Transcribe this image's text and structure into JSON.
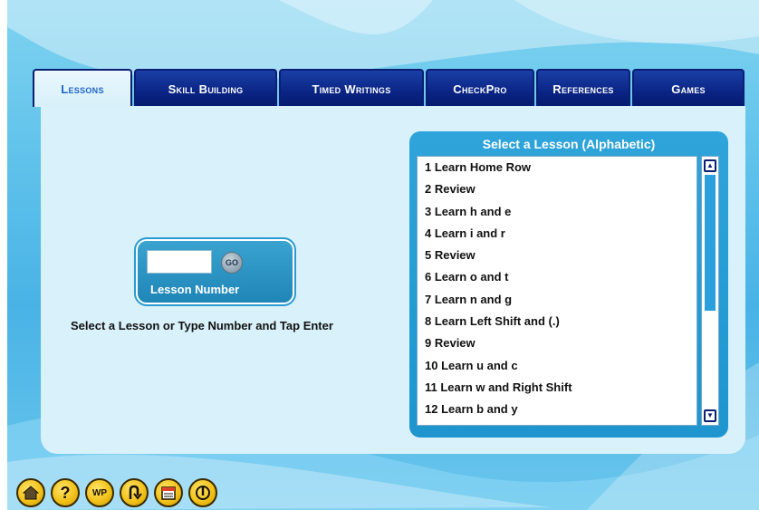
{
  "tabs": [
    {
      "label": "Lessons",
      "active": true
    },
    {
      "label": "Skill Building",
      "active": false
    },
    {
      "label": "Timed Writings",
      "active": false
    },
    {
      "label": "CheckPro",
      "active": false
    },
    {
      "label": "References",
      "active": false
    },
    {
      "label": "Games",
      "active": false
    }
  ],
  "lesson_number": {
    "input_value": "",
    "go_label": "GO",
    "label": "Lesson Number"
  },
  "instruction": "Select a Lesson or Type Number and Tap Enter",
  "lesson_list": {
    "title": "Select a Lesson (Alphabetic)",
    "items": [
      "1  Learn Home Row",
      "2  Review",
      "3  Learn h and e",
      "4  Learn i and r",
      "5  Review",
      "6  Learn o and t",
      "7  Learn n and g",
      "8  Learn Left Shift and (.)",
      "9  Review",
      "10  Learn u and c",
      "11  Learn w and Right Shift",
      "12  Learn b and y"
    ],
    "scroll_up_icon": "triangle-up",
    "scroll_down_icon": "triangle-down"
  },
  "toolbar": {
    "buttons": [
      {
        "name": "home",
        "icon": "home-icon",
        "glyph": ""
      },
      {
        "name": "help",
        "icon": "question-icon",
        "glyph": "?"
      },
      {
        "name": "word-processor",
        "icon": "wp-icon",
        "glyph": "WP"
      },
      {
        "name": "return",
        "icon": "u-turn-icon",
        "glyph": ""
      },
      {
        "name": "notes",
        "icon": "notepad-icon",
        "glyph": ""
      },
      {
        "name": "power",
        "icon": "power-icon",
        "glyph": ""
      }
    ]
  },
  "colors": {
    "tab_bg": "#0a2484",
    "tab_active_bg": "#d7f0fa",
    "tab_active_text": "#1e64c8",
    "panel_bg": "#d9f1fa",
    "list_panel_bg": "#2ea4da",
    "toolbar_button": "#f2c21a"
  }
}
